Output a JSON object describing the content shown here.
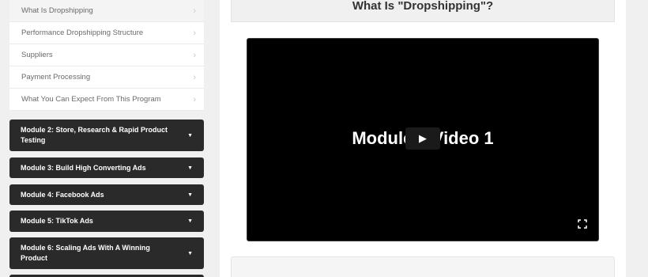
{
  "sidebar": {
    "lessons": [
      {
        "label": "What Is Dropshipping",
        "active": true
      },
      {
        "label": "Performance Dropshipping Structure"
      },
      {
        "label": "Suppliers"
      },
      {
        "label": "Payment Processing"
      },
      {
        "label": "What You Can Expect From This Program"
      }
    ],
    "modules": [
      {
        "label": "Module 2: Store, Research & Rapid Product Testing"
      },
      {
        "label": "Module 3: Build High Converting Ads"
      },
      {
        "label": "Module 4: Facebook Ads"
      },
      {
        "label": "Module 5: TikTok Ads"
      },
      {
        "label": "Module 6: Scaling Ads With A Winning Product"
      }
    ]
  },
  "main": {
    "title": "What Is \"Dropshipping\"?",
    "video": {
      "title": "Module 1 Video 1",
      "play_icon": "play-icon",
      "fullscreen_icon": "fullscreen-icon"
    }
  }
}
